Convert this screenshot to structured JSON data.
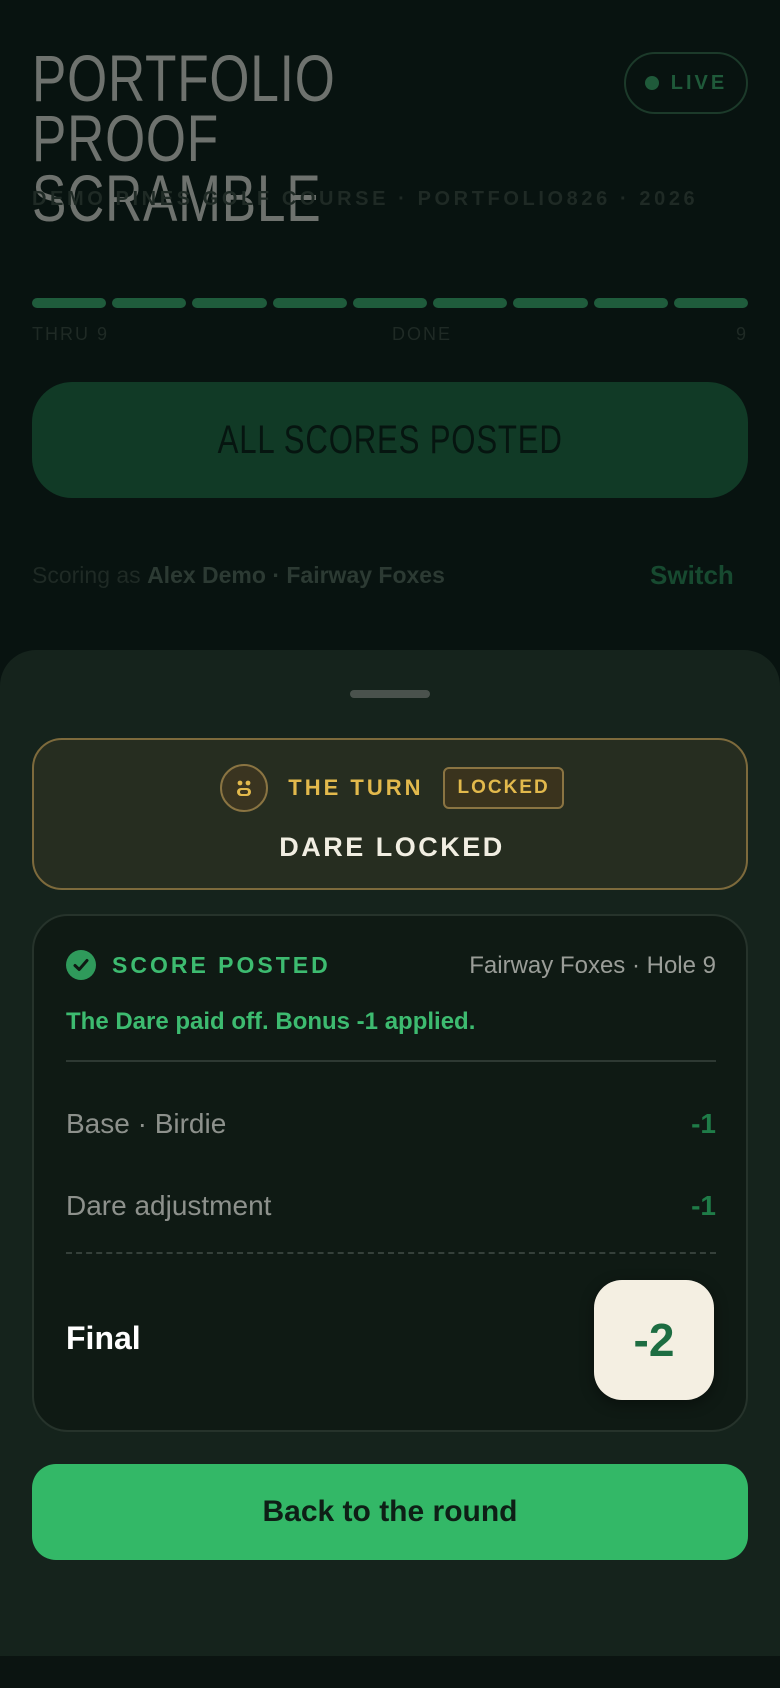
{
  "header": {
    "title": "PORTFOLIO PROOF SCRAMBLE",
    "subtitle": "DEMO PINES GOLF COURSE · PORTFOLIO826 · 2026",
    "live_label": "LIVE"
  },
  "progress": {
    "segments_total": 9,
    "segments_done": 9,
    "left_label": "THRU 9",
    "center_label": "DONE",
    "right_label": "9"
  },
  "status_button": {
    "label": "ALL SCORES POSTED"
  },
  "scoring": {
    "prefix": "Scoring as",
    "player_team": "Alex Demo · Fairway Foxes",
    "switch_label": "Switch"
  },
  "sheet": {
    "turn": {
      "label": "THE TURN",
      "badge": "LOCKED",
      "status": "DARE LOCKED"
    },
    "score": {
      "posted_label": "SCORE POSTED",
      "team_hole": "Fairway Foxes · Hole 9",
      "message": "The Dare paid off. Bonus -1 applied.",
      "lines": [
        {
          "label": "Base · Birdie",
          "value": "-1"
        },
        {
          "label": "Dare adjustment",
          "value": "-1"
        }
      ],
      "final_label": "Final",
      "final_value": "-2"
    },
    "back_button": "Back to the round"
  },
  "colors": {
    "accent_green": "#33b867",
    "gold": "#e2b94c",
    "sheet_bg": "#15231c"
  }
}
